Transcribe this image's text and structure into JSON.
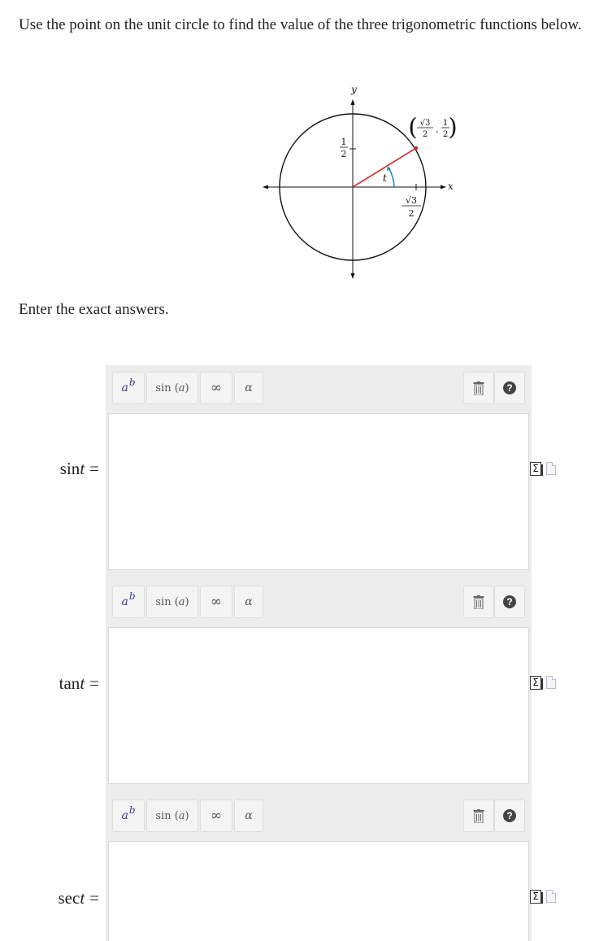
{
  "question": {
    "prompt": "Use the point on the unit circle to find the value of the three trigonometric functions below.",
    "instruction": "Enter the exact answers."
  },
  "figure": {
    "x_axis_label": "x",
    "y_axis_label": "y",
    "angle_label": "t",
    "y_tick_label": {
      "numerator": "1",
      "denominator": "2"
    },
    "x_tick_label": {
      "numerator": "√3",
      "denominator": "2"
    },
    "point_label": {
      "x_numerator": "√3",
      "x_denominator": "2",
      "comma": ",",
      "y_numerator": "1",
      "y_denominator": "2"
    },
    "radius_color": "#cc2222",
    "angle_arc_color": "#1a8fb5"
  },
  "toolbar": {
    "exponent_base": "a",
    "exponent_sup": "b",
    "trig_func": "sin",
    "trig_arg": "a",
    "infinity": "∞",
    "greek": "α",
    "help": "?",
    "trash_icon": "trash-icon",
    "help_icon": "question-circle-icon"
  },
  "answers": [
    {
      "func": "sin",
      "var": "t",
      "eq": "="
    },
    {
      "func": "tan",
      "var": "t",
      "eq": "="
    },
    {
      "func": "sec",
      "var": "t",
      "eq": "="
    }
  ],
  "side_icons": {
    "sigma": "Σ"
  }
}
